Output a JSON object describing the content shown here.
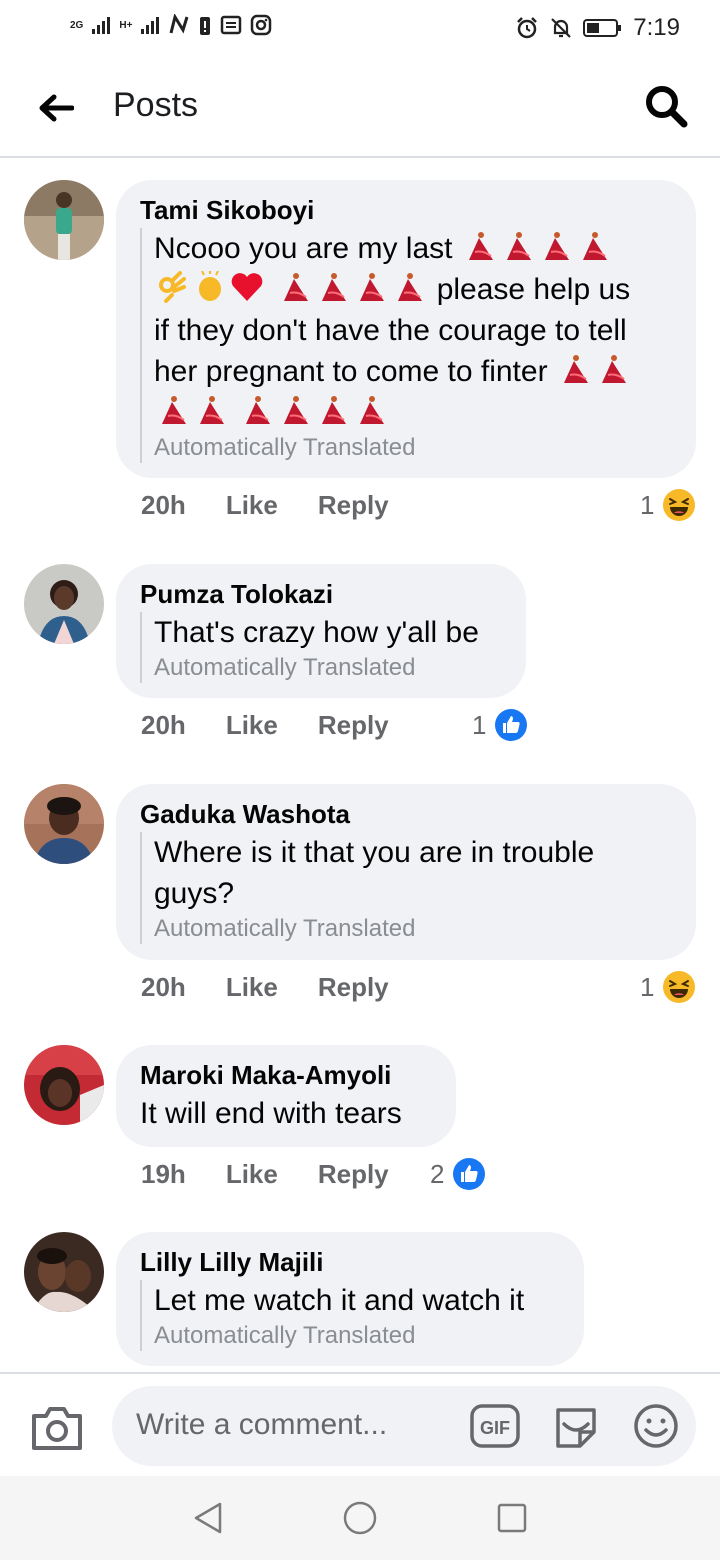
{
  "status_bar": {
    "network_1": "2G",
    "network_2": "H+",
    "time": "7:19"
  },
  "header": {
    "title": "Posts"
  },
  "comments": [
    {
      "author": "Tami Sikoboyi",
      "lines": [
        "Ncooo you are my last",
        "please help us",
        "if they don't have the courage to tell",
        "her pregnant to come to finter"
      ],
      "translated": "Automatically Translated",
      "time": "20h",
      "like": "Like",
      "reply": "Reply",
      "reaction_count": "1",
      "reaction": "haha"
    },
    {
      "author": "Pumza Tolokazi",
      "text": "That's crazy how y'all be",
      "translated": "Automatically Translated",
      "time": "20h",
      "like": "Like",
      "reply": "Reply",
      "reaction_count": "1",
      "reaction": "like"
    },
    {
      "author": "Gaduka Washota",
      "lines": [
        "Where is it that you are in trouble",
        "guys?"
      ],
      "translated": "Automatically Translated",
      "time": "20h",
      "like": "Like",
      "reply": "Reply",
      "reaction_count": "1",
      "reaction": "haha"
    },
    {
      "author": "Maroki Maka-Amyoli",
      "text": "It will end with tears",
      "time": "19h",
      "like": "Like",
      "reply": "Reply",
      "reaction_count": "2",
      "reaction": "like"
    },
    {
      "author": "Lilly Lilly Majili",
      "text": "Let me watch it and watch it",
      "translated": "Automatically Translated"
    }
  ],
  "composer": {
    "placeholder": "Write a comment...",
    "gif_label": "GIF"
  },
  "colors": {
    "like_blue": "#1877f2",
    "haha_yellow": "#f7b928",
    "bubble_bg": "#f0f2f5",
    "muted_text": "#65676b"
  }
}
